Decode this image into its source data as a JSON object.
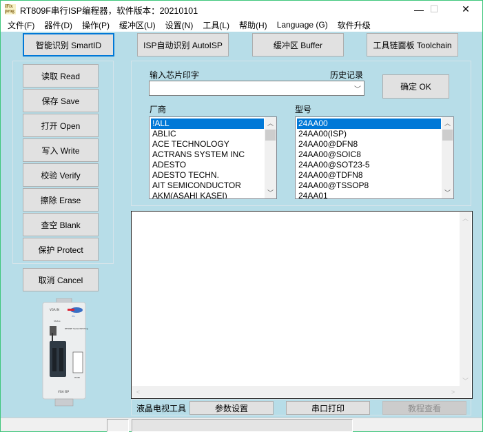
{
  "window": {
    "title": "RT809F串行ISP编程器，软件版本：20210101",
    "app_icon_text": "iFix prog",
    "controls": {
      "minimize": "—",
      "maximize": "☐",
      "close": "✕"
    }
  },
  "menubar": {
    "items": [
      {
        "label": "文件(F)"
      },
      {
        "label": "器件(D)"
      },
      {
        "label": "操作(P)"
      },
      {
        "label": "缓冲区(U)"
      },
      {
        "label": "设置(N)"
      },
      {
        "label": "工具(L)"
      },
      {
        "label": "帮助(H)"
      },
      {
        "label": "Language (G)"
      },
      {
        "label": "软件升级"
      }
    ]
  },
  "toolbar": {
    "smartid": "智能识别 SmartID",
    "autoisp": "ISP自动识别 AutoISP",
    "buffer": "缓冲区 Buffer",
    "toolchain": "工具链面板 Toolchain"
  },
  "actions": {
    "read": "读取 Read",
    "save": "保存 Save",
    "open": "打开 Open",
    "write": "写入 Write",
    "verify": "校验 Verify",
    "erase": "擦除 Erase",
    "blank": "查空 Blank",
    "protect": "保护 Protect",
    "cancel": "取消 Cancel"
  },
  "device_image": {
    "label_top": "VGA IN",
    "label_model": "RT809F Serial ISP Programmer",
    "label_bottom": "VGA ISP",
    "label_hdmi": "HDMI",
    "label_status": "Status"
  },
  "chip_select": {
    "input_label": "输入芯片印字",
    "history_label": "历史记录",
    "input_value": "",
    "ok_button": "确定 OK",
    "vendor_label": "厂商",
    "model_label": "型号",
    "vendors": [
      "!ALL",
      "ABLIC",
      "ACE TECHNOLOGY",
      "ACTRANS SYSTEM INC",
      "ADESTO",
      "ADESTO TECHN.",
      "AIT SEMICONDUCTOR",
      "AKM(ASAHI KASEI)"
    ],
    "vendor_selected": "!ALL",
    "models": [
      "24AA00",
      "24AA00(ISP)",
      "24AA00@DFN8",
      "24AA00@SOIC8",
      "24AA00@SOT23-5",
      "24AA00@TDFN8",
      "24AA00@TSSOP8",
      "24AA01"
    ],
    "model_selected": "24AA00"
  },
  "log": {
    "content": ""
  },
  "bottom_tools": {
    "label": "液晶电视工具",
    "params": "参数设置",
    "serial_print": "串口打印",
    "tutorial": "教程查看"
  },
  "statusbar": {
    "panels": [
      "",
      "",
      ""
    ]
  }
}
